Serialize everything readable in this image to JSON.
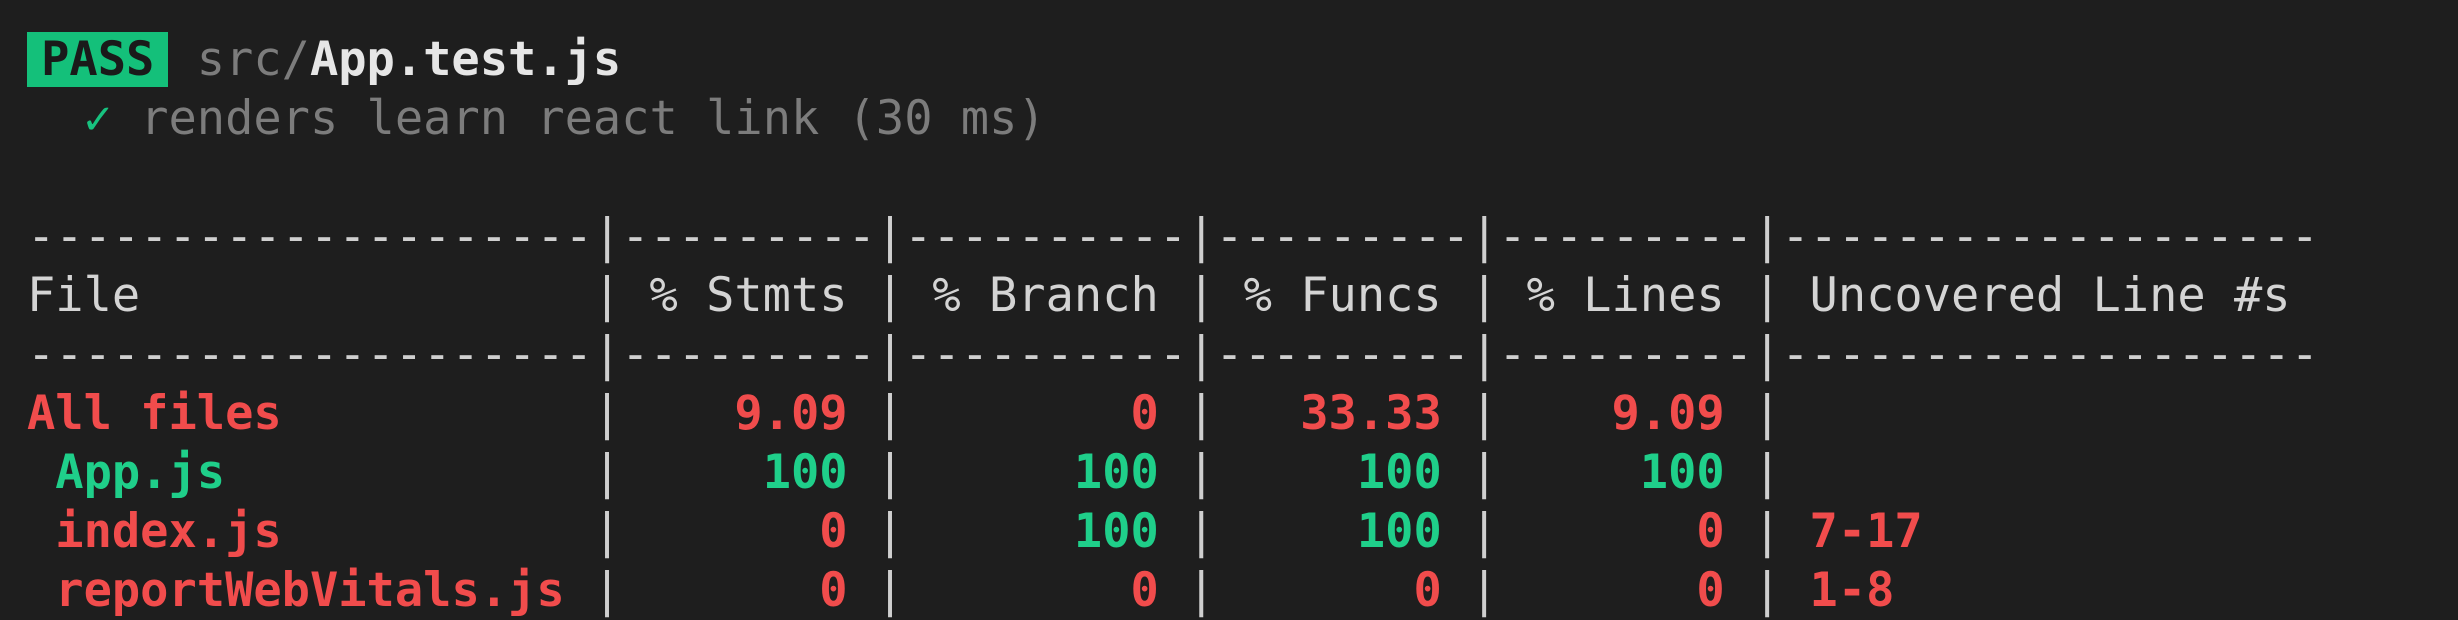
{
  "result": {
    "status": "PASS",
    "path_dir": "src/",
    "path_file": "App.test.js",
    "test_check": "✓",
    "test_name": "renders learn react link (30 ms)"
  },
  "colors": {
    "pass": "#14c07a",
    "red": "#f14c4c",
    "green": "#1fcf8a",
    "background": "#1e1e1e"
  },
  "coverage": {
    "headers": [
      "File",
      "% Stmts",
      "% Branch",
      "% Funcs",
      "% Lines",
      "Uncovered Line #s"
    ],
    "rows": [
      {
        "file": "All files",
        "stmts": "9.09",
        "branch": "0",
        "funcs": "33.33",
        "lines": "9.09",
        "uncovered": "",
        "colors": [
          "red",
          "red",
          "red",
          "red",
          "red",
          "red"
        ]
      },
      {
        "file": " App.js",
        "stmts": "100",
        "branch": "100",
        "funcs": "100",
        "lines": "100",
        "uncovered": "",
        "colors": [
          "green",
          "green",
          "green",
          "green",
          "green",
          "red"
        ]
      },
      {
        "file": " index.js",
        "stmts": "0",
        "branch": "100",
        "funcs": "100",
        "lines": "0",
        "uncovered": "7-17",
        "colors": [
          "red",
          "red",
          "green",
          "green",
          "red",
          "red"
        ]
      },
      {
        "file": " reportWebVitals.js",
        "stmts": "0",
        "branch": "0",
        "funcs": "0",
        "lines": "0",
        "uncovered": "1-8",
        "colors": [
          "red",
          "red",
          "red",
          "red",
          "red",
          "red"
        ]
      }
    ]
  }
}
